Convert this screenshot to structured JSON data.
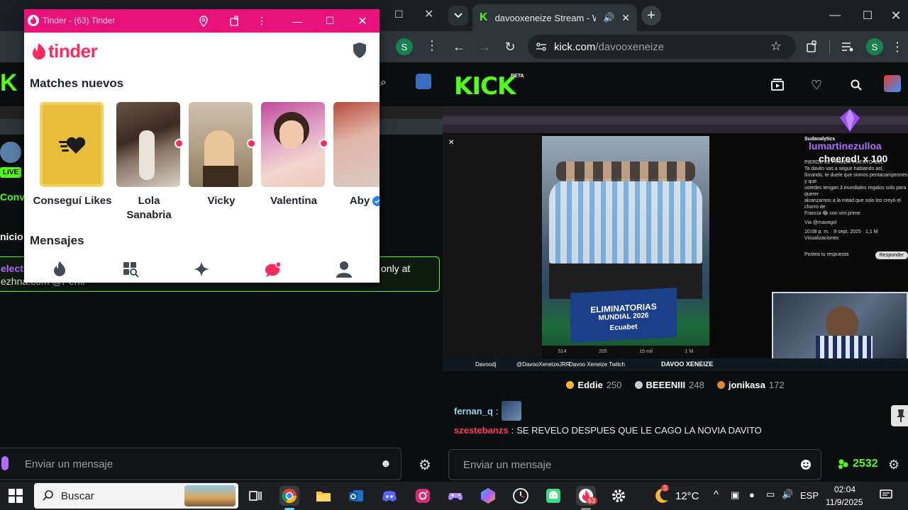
{
  "left_window": {
    "partial_texts": {
      "conve": "Conve",
      "inicio": "nicio",
      "live": "LIVE",
      "msg_user": "electi",
      "msg_tail": "only at",
      "msg_line2": "ezhna.com @Perfil"
    },
    "chat_placeholder": "Enviar un mensaje"
  },
  "tinder": {
    "window_title": "Tinder - (63) Tinder",
    "logo_text": "tinder",
    "matches_title": "Matches nuevos",
    "matches": [
      {
        "name": "Conseguí Likes",
        "type": "likes"
      },
      {
        "name": "Lola Sanabria",
        "new": true
      },
      {
        "name": "Vicky",
        "new": true
      },
      {
        "name": "Valentina",
        "new": true
      },
      {
        "name": "Aby",
        "verified": true
      }
    ],
    "messages_title": "Mensajes",
    "nav_icons": [
      "flame-icon",
      "explore-icon",
      "sparkle-icon",
      "chat-icon",
      "profile-icon"
    ],
    "brand_color": "#fd2a5e",
    "titlebar_color": "#e8137a"
  },
  "kick": {
    "tab_title": "davooxeneize Stream - Wat",
    "url_host": "kick.com",
    "url_path": "/davooxeneize",
    "profile_letter": "S",
    "logo": "KICK",
    "logo_badge": "BETA",
    "video": {
      "cheer_name": "lumartinezulloa",
      "cheer_text": "cheered! x 100",
      "tweet_author": "Sudanalytics",
      "tweet_lines": [
        "PIERDE EL PRIMER PUESTO DEL",
        "Ta davito vas a seguir hablando así,",
        "llorando, te duele que somos pentacampeones y que",
        "ustedes tengan 3 mundiales regalos solo para querer",
        "alcanzarnos a la mitad que solo los creyó el chorro de",
        "Francia 😂 con vini prime",
        "Via @mavegol",
        "10:08 p. m. · 9 sept. 2025 · 1,1 M",
        "Visualizaciones",
        "Postea tu respuesta",
        "Responder"
      ],
      "banner_line1": "ELIMINATORIAS",
      "banner_line2": "MUNDIAL 2026",
      "banner_sponsors": "Ecuabet",
      "stats": [
        "514",
        "205",
        "15 mil",
        "1 M"
      ],
      "bottom_items": [
        "Davoodj",
        "@DavooXeneizeJRR",
        "Davoo Xeneize Twitch",
        "DAVOO XENEIZE"
      ]
    },
    "leaderboard": [
      {
        "name": "Eddie",
        "score": "250",
        "color": "#f5b82e"
      },
      {
        "name": "BEEENIII",
        "score": "248",
        "color": "#c9cdd2"
      },
      {
        "name": "jonikasa",
        "score": "172",
        "color": "#d9893a"
      }
    ],
    "chat": [
      {
        "user": "fernan_q",
        "text": "",
        "emote": true
      },
      {
        "user": "szestebanzs",
        "text": "SE REVELO DESPUES QUE LE CAGO LA NOVIA DAVITO"
      }
    ],
    "chat_placeholder": "Enviar un mensaje",
    "points": "2532",
    "accent": "#53fc18"
  },
  "taskbar": {
    "search_placeholder": "Buscar",
    "weather": "12°C",
    "weather_badge": "3",
    "tinder_badge": "63",
    "lang": "ESP",
    "time": "02:04",
    "date": "11/9/2025",
    "apps": [
      "task-view-icon",
      "chrome-icon",
      "file-explorer-icon",
      "outlook-icon",
      "discord-icon",
      "instagram-icon",
      "gamepad-icon",
      "copilot-icon",
      "clock-app-icon",
      "android-icon",
      "tinder-app-icon",
      "settings-icon"
    ]
  }
}
